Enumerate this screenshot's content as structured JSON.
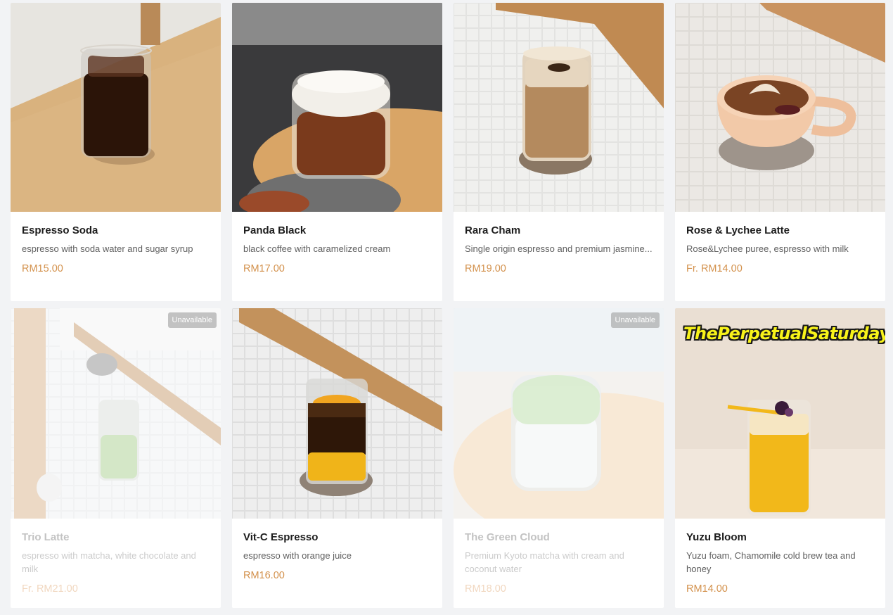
{
  "menu": {
    "items": [
      {
        "name": "Espresso Soda",
        "description": "espresso with soda water and sugar syrup",
        "price": "RM15.00"
      },
      {
        "name": "Panda Black",
        "description": "black coffee with caramelized cream",
        "price": "RM17.00"
      },
      {
        "name": "Rara Cham",
        "description": "Single origin espresso and premium jasmine...",
        "price": "RM19.00"
      },
      {
        "name": "Rose & Lychee Latte",
        "description": "Rose&Lychee puree, espresso with milk",
        "price": "Fr. RM14.00"
      },
      {
        "name": "Trio Latte",
        "description": "espresso with matcha, white chocolate and milk",
        "price": "Fr. RM21.00",
        "badge": "Unavailable"
      },
      {
        "name": "Vit-C Espresso",
        "description": "espresso with orange juice",
        "price": "RM16.00"
      },
      {
        "name": "The Green Cloud",
        "description": "Premium Kyoto matcha with cream and coconut water",
        "price": "RM18.00",
        "badge": "Unavailable"
      },
      {
        "name": "Yuzu Bloom",
        "description": "Yuzu foam, Chamomile cold brew tea and honey",
        "price": "RM14.00"
      }
    ]
  },
  "watermark": "ThePerpetualSaturday",
  "colors": {
    "price": "#d3914c",
    "background": "#f2f3f5",
    "card": "#ffffff"
  }
}
